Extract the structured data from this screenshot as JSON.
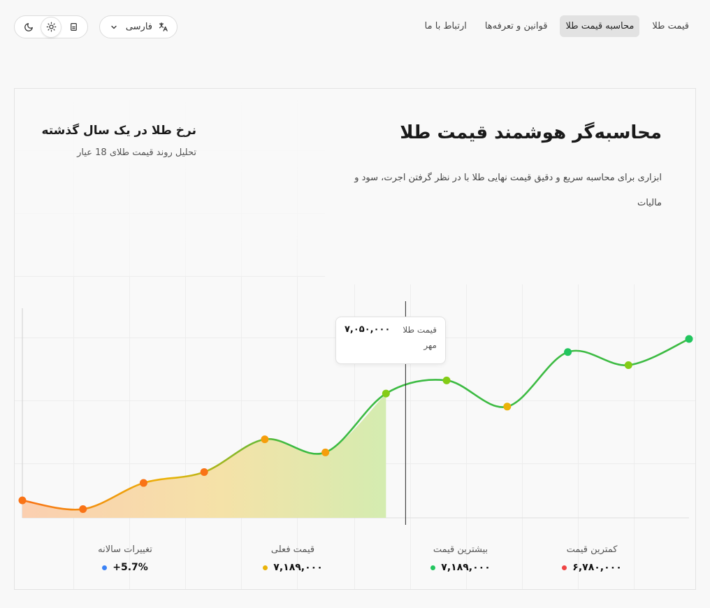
{
  "nav": {
    "items": [
      {
        "label": "قیمت طلا",
        "active": false
      },
      {
        "label": "محاسبه قیمت طلا",
        "active": true
      },
      {
        "label": "قوانین و تعرفه‌ها",
        "active": false
      },
      {
        "label": "ارتباط با ما",
        "active": false
      }
    ]
  },
  "language": {
    "selected": "فارسی"
  },
  "hero": {
    "title": "محاسبه‌گر هوشمند قیمت طلا",
    "description": "ابزاری برای محاسبه سریع و دقیق قیمت نهایی طلا با در نظر گرفتن اجرت، سود و مالیات"
  },
  "chart_header": {
    "title": "نرخ طلا در یک سال گذشته",
    "subtitle": "تحلیل روند قیمت طلای 18 عیار"
  },
  "tooltip": {
    "label": "قیمت طلا",
    "value": "۷,۰۵۰,۰۰۰",
    "month": "مهر"
  },
  "chart_data": {
    "type": "area",
    "x_direction": "left-to-right",
    "points": [
      {
        "i": 0,
        "y": 6830000
      },
      {
        "i": 1,
        "y": 6790000
      },
      {
        "i": 2,
        "y": 6910000
      },
      {
        "i": 3,
        "y": 6960000
      },
      {
        "i": 4,
        "y": 7110000
      },
      {
        "i": 5,
        "y": 7050000
      },
      {
        "i": 6,
        "y": 7320000
      },
      {
        "i": 7,
        "y": 7380000
      },
      {
        "i": 8,
        "y": 7260000
      },
      {
        "i": 9,
        "y": 7510000
      },
      {
        "i": 10,
        "y": 7450000
      },
      {
        "i": 11,
        "y": 7570000
      }
    ],
    "highlight_index": 6,
    "ylim": [
      6750000,
      7820000
    ],
    "grid": true,
    "colors": {
      "line": "#3dbb43",
      "low": "#f97316",
      "mid": "#eab308",
      "high": "#84cc16",
      "top": "#22c55e"
    }
  },
  "stats": [
    {
      "label": "کمترین قیمت",
      "value": "۶,۷۸۰,۰۰۰",
      "color": "#ef4444"
    },
    {
      "label": "بیشترین قیمت",
      "value": "۷,۱۸۹,۰۰۰",
      "color": "#22c55e"
    },
    {
      "label": "قیمت فعلی",
      "value": "۷,۱۸۹,۰۰۰",
      "color": "#eab308"
    },
    {
      "label": "تغییرات سالانه",
      "value": "5.7%+",
      "color": "#3b82f6"
    }
  ]
}
